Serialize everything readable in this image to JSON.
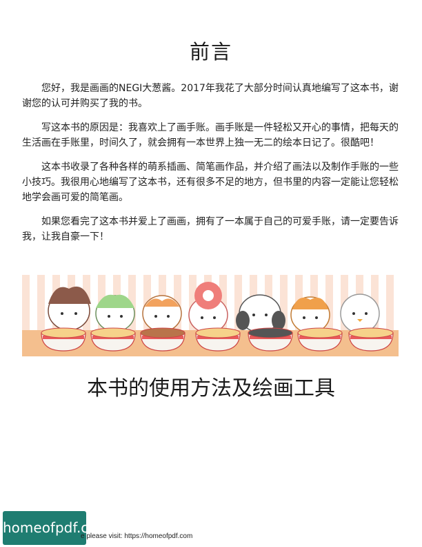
{
  "page": {
    "title": "前言",
    "paragraphs": [
      "您好，我是画画的NEGI大葱酱。2017年我花了大部分时间认真地编写了这本书，谢谢您的认可并购买了我的书。",
      "写这本书的原因是：我喜欢上了画手账。画手账是一件轻松又开心的事情，把每天的生活画在手账里，时间久了，就会拥有一本世界上独一无二的绘本日记了。很酷吧！",
      "这本书收录了各种各样的萌系插画、简笔画作品，并介绍了画法以及制作手账的一些小技巧。我很用心地编写了这本书，还有很多不足的地方，但书里的内容一定能让您轻松地学会画可爱的简笔画。",
      "如果您看完了这本书并爱上了画画，拥有了一本属于自己的可爱手账，请一定要告诉我，让我自豪一下！"
    ],
    "section_title": "本书的使用方法及绘画工具"
  },
  "banner": {
    "description_icon": "cute-animals-eating-ramen-illustration",
    "colors": {
      "stripe_a": "#fbe3d6",
      "stripe_b": "#ffffff",
      "table": "#f4bf8e",
      "bowl": "#f7f4ef",
      "bowl_band": "#e95b5b"
    }
  },
  "watermark": {
    "logo_text": "homeofpdf.com",
    "footer_text": "e please visit: https://homeofpdf.com"
  }
}
